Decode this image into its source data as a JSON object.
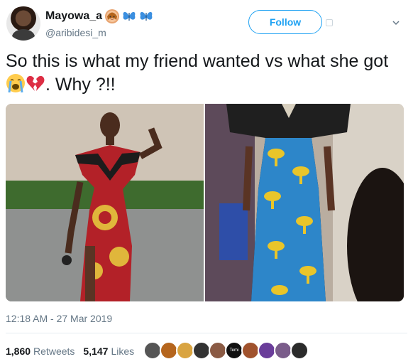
{
  "user": {
    "display_name": "Mayowa_a",
    "emojis": [
      "woman-icon",
      "butterfly-icon",
      "butterfly-icon"
    ],
    "handle": "@aribidesi_m",
    "follow_label": "Follow"
  },
  "tweet": {
    "text_part1": "So this is what my friend wanted vs what she got ",
    "text_part2": ". Why ?!!",
    "emojis_inline": [
      "loudly-crying-face-icon",
      "broken-heart-icon"
    ]
  },
  "media": {
    "photos": [
      "photo-wanted",
      "photo-got"
    ]
  },
  "meta": {
    "timestamp": "12:18 AM - 27 Mar 2019",
    "retweets_count": "1,860",
    "retweets_label": "Retweets",
    "likes_count": "5,147",
    "likes_label": "Likes",
    "liker_badge": "Temi"
  },
  "colors": {
    "accent": "#1da1f2",
    "secondary_text": "#657786",
    "divider": "#e6ecf0"
  }
}
